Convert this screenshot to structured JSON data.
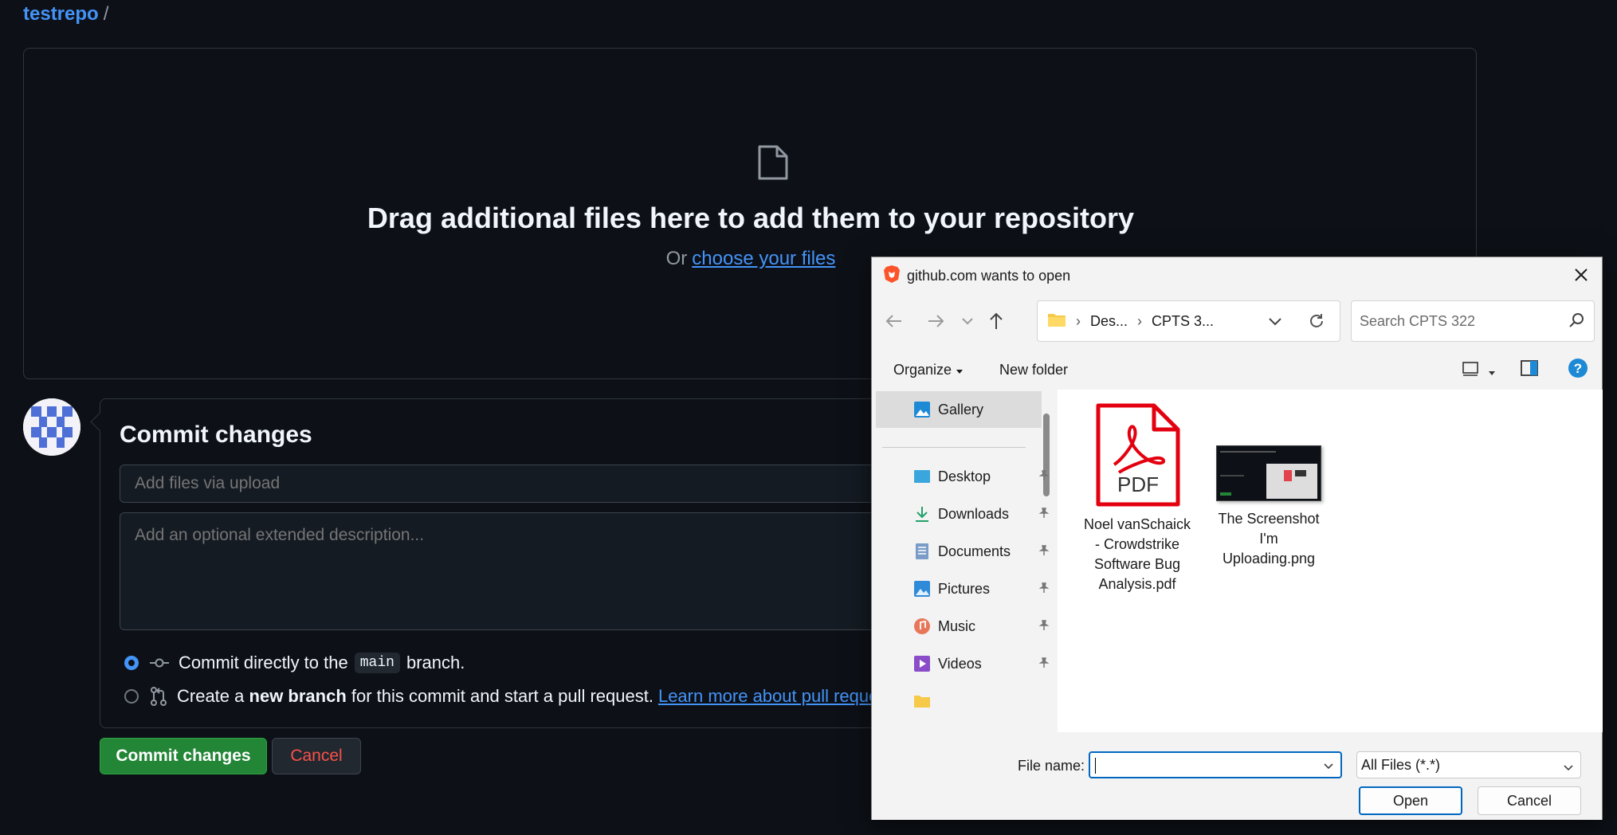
{
  "breadcrumb": {
    "repo": "testrepo",
    "separator": "/"
  },
  "dropzone": {
    "title": "Drag additional files here to add them to your repository",
    "or_text": "Or",
    "choose_link": "choose your files"
  },
  "commit": {
    "title": "Commit changes",
    "summary_placeholder": "Add files via upload",
    "description_placeholder": "Add an optional extended description...",
    "option_direct": {
      "prefix": "Commit directly to the",
      "branch": "main",
      "suffix": "branch.",
      "checked": true
    },
    "option_new_branch": {
      "prefix": "Create a",
      "bold": "new branch",
      "suffix": "for this commit and start a pull request.",
      "link": "Learn more about pull requests.",
      "checked": false
    },
    "commit_button": "Commit changes",
    "cancel_button": "Cancel"
  },
  "dialog": {
    "title": "github.com wants to open",
    "address": {
      "crumbs": [
        "Des...",
        "CPTS 3..."
      ]
    },
    "search_placeholder": "Search CPTS 322",
    "toolbar": {
      "organize": "Organize",
      "new_folder": "New folder",
      "help": "?"
    },
    "nav": {
      "gallery": "Gallery",
      "items": [
        "Desktop",
        "Downloads",
        "Documents",
        "Pictures",
        "Music",
        "Videos"
      ]
    },
    "files": [
      {
        "name": "Noel vanSchaick - Crowdstrike Software Bug Analysis.pdf",
        "lines": [
          "Noel vanSchaick",
          "- Crowdstrike",
          "Software Bug",
          "Analysis.pdf"
        ],
        "icon": "pdf-icon",
        "icon_label": "PDF"
      },
      {
        "name": "The Screenshot I'm Uploading.png",
        "lines": [
          "The Screenshot",
          "I'm",
          "Uploading.png"
        ],
        "icon": "image-thumbnail"
      }
    ],
    "file_name_label": "File name:",
    "file_name_value": "",
    "file_type": "All Files (*.*)",
    "open_button": "Open",
    "cancel_button": "Cancel"
  },
  "colors": {
    "page_bg": "#0d1117",
    "accent_link": "#4493f8",
    "commit_green": "#238636",
    "danger_red": "#f85149",
    "windows_accent": "#0067c0",
    "pdf_red": "#e3000f"
  }
}
